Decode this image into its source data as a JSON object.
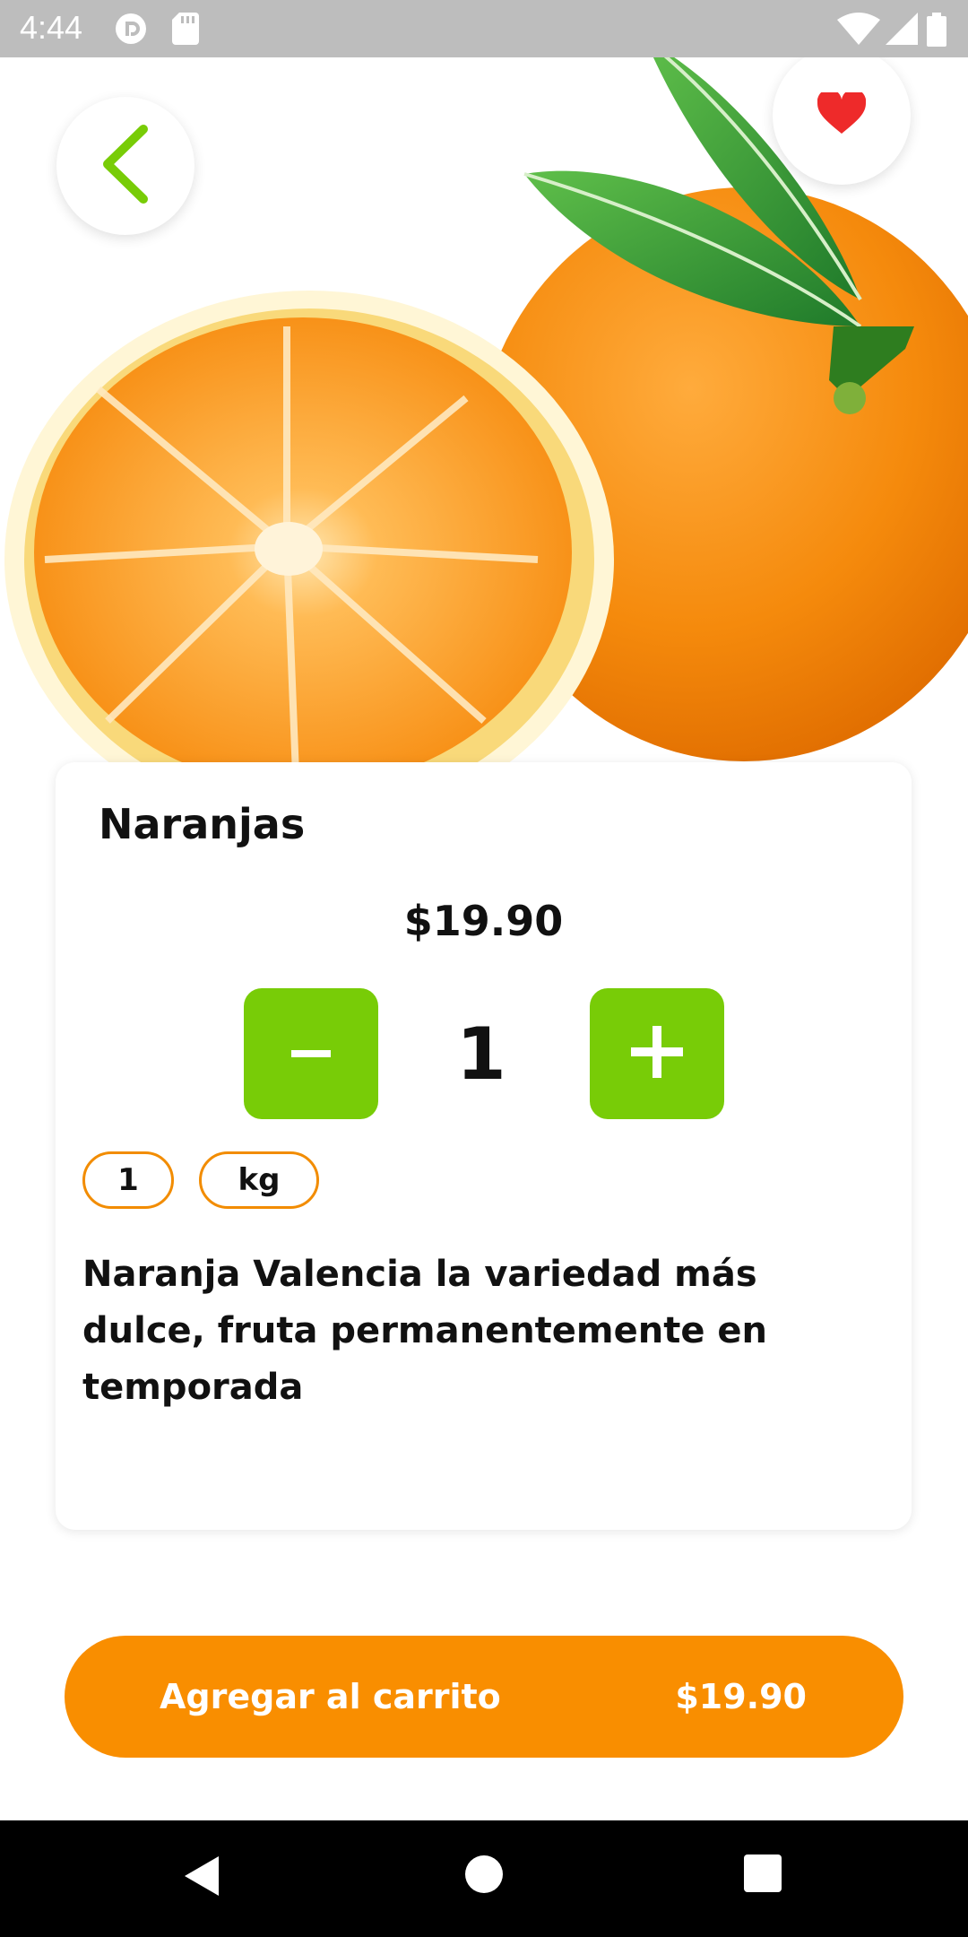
{
  "status_bar": {
    "time": "4:44",
    "icons": [
      "pocket-casts-icon",
      "sd-card-icon",
      "wifi-icon",
      "cell-signal-icon",
      "battery-icon"
    ]
  },
  "header": {
    "back_icon": "chevron-left-icon",
    "favorite_icon": "heart-icon"
  },
  "product": {
    "name": "Naranjas",
    "price": "$19.90",
    "quantity": "1",
    "unit_amount": "1",
    "unit": "kg",
    "description": "Naranja Valencia la variedad más dulce, fruta permanentemente en temporada"
  },
  "quantity_controls": {
    "minus_label": "−",
    "plus_label": "+"
  },
  "cart_button": {
    "label": "Agregar al carrito",
    "price": "$19.90"
  },
  "nav_bar": {
    "icons": [
      "back-triangle-icon",
      "home-circle-icon",
      "recents-square-icon"
    ]
  },
  "colors": {
    "accent_green": "#78cc07",
    "accent_orange": "#f98e00",
    "chip_border": "#f28c00",
    "heart": "#ee2a2a",
    "status_bar": "#bdbdbd",
    "nav_bar": "#000000"
  }
}
